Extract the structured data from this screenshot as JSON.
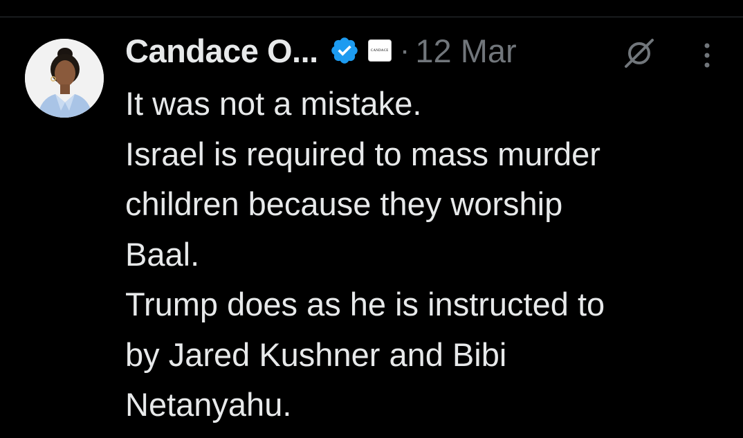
{
  "tweet": {
    "author": {
      "display_name": "Candace O...",
      "verified": true,
      "affiliate_badge_text": "CANDACE"
    },
    "separator": "·",
    "timestamp": "12 Mar",
    "text_lines": [
      "It was not a mistake.",
      "Israel is required to mass murder",
      "children because they worship",
      "Baal.",
      "Trump does as he is instructed to",
      "by Jared Kushner and Bibi",
      "Netanyahu."
    ]
  },
  "icons": {
    "avatar": "profile-photo",
    "verified": "verified-check-icon",
    "grok": "grok-icon",
    "more": "more-options-icon"
  },
  "colors": {
    "background": "#000000",
    "text_primary": "#e7e9ea",
    "text_secondary": "#71767b",
    "verified_blue": "#1d9bf0"
  }
}
